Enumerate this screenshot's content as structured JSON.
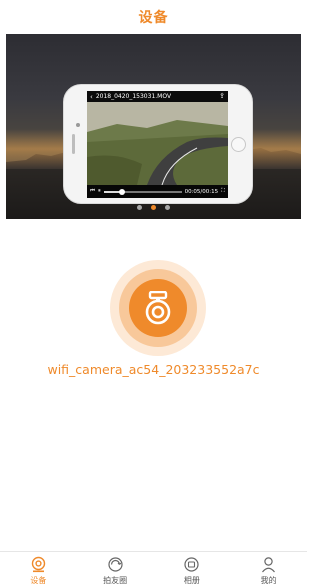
{
  "header": {
    "title": "设备"
  },
  "banner": {
    "video": {
      "filename": "2018_0420_153031.MOV",
      "time": "00:05/00:15"
    },
    "pages": 3,
    "active_page": 1
  },
  "device": {
    "name": "wifi_camera_ac54_203233552a7c",
    "icon": "dashcam-icon"
  },
  "tabbar": {
    "items": [
      {
        "label": "设备",
        "icon": "device-icon",
        "active": true
      },
      {
        "label": "拍友圈",
        "icon": "friends-circle-icon",
        "active": false
      },
      {
        "label": "相册",
        "icon": "album-icon",
        "active": false
      },
      {
        "label": "我的",
        "icon": "profile-icon",
        "active": false
      }
    ]
  },
  "colors": {
    "accent": "#ef8a2b",
    "accent_light": "#f8c89a",
    "accent_pale": "#fde9d6",
    "text_gray": "#555555"
  }
}
